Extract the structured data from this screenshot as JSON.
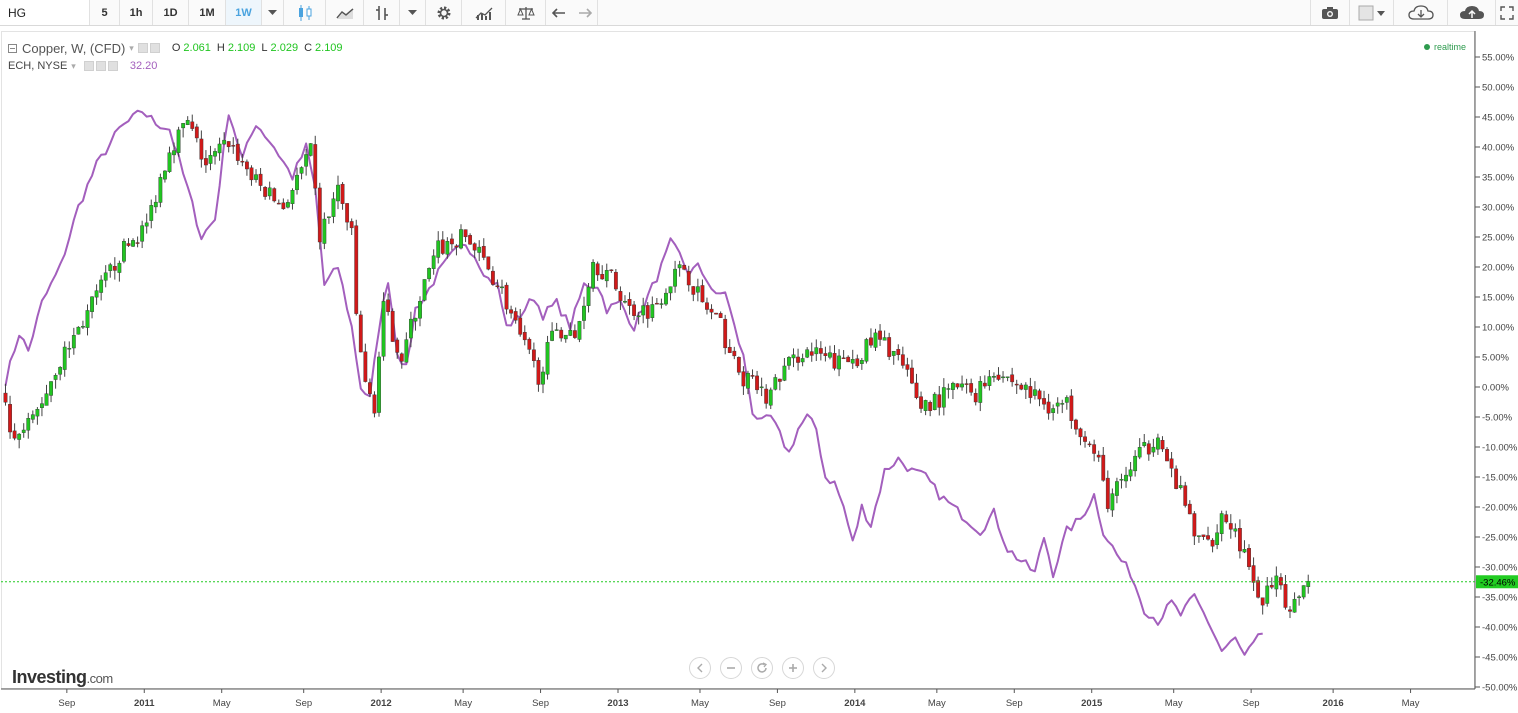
{
  "toolbar": {
    "symbol_value": "HG",
    "intervals": [
      "5",
      "1h",
      "1D",
      "1M",
      "1W"
    ],
    "active_interval": "1W"
  },
  "legend": {
    "main_name": "Copper, W, (CFD)",
    "o_label": "O",
    "o_value": "2.061",
    "h_label": "H",
    "h_value": "2.109",
    "l_label": "L",
    "l_value": "2.029",
    "c_label": "C",
    "c_value": "2.109",
    "compare_name": "ECH, NYSE",
    "compare_value": "32.20"
  },
  "realtime_label": "realtime",
  "logo": {
    "main": "Investing",
    "suffix": ".com"
  },
  "colors": {
    "up": "#21c521",
    "down": "#d11919",
    "compare_line": "#a35fbd",
    "current_line": "#22cc22"
  },
  "chart_data": {
    "type": "candlestick_with_compare_line",
    "y_axis": {
      "unit": "%",
      "ticks": [
        "55.00%",
        "50.00%",
        "45.00%",
        "40.00%",
        "35.00%",
        "30.00%",
        "25.00%",
        "20.00%",
        "15.00%",
        "10.00%",
        "5.00%",
        "0.00%",
        "-5.00%",
        "-10.00%",
        "-15.00%",
        "-20.00%",
        "-25.00%",
        "-30.00%",
        "-35.00%",
        "-40.00%",
        "-45.00%",
        "-50.00%"
      ],
      "ylim": [
        -51,
        56
      ]
    },
    "x_axis": {
      "ticks": [
        "Sep",
        "2011",
        "May",
        "Sep",
        "2012",
        "May",
        "Sep",
        "2013",
        "May",
        "Sep",
        "2014",
        "May",
        "Sep",
        "2015",
        "May",
        "Sep",
        "2016",
        "May"
      ],
      "bold_ticks": [
        "2011",
        "2012",
        "2013",
        "2014",
        "2015",
        "2016"
      ],
      "range_weeks": [
        -14,
        299
      ]
    },
    "current_value_label": "-32.46%",
    "current_value": -32.46,
    "main_series": {
      "name": "Copper, W, (CFD)",
      "anchors": [
        [
          0,
          -1
        ],
        [
          3,
          -10
        ],
        [
          8,
          -4
        ],
        [
          12,
          3
        ],
        [
          18,
          11
        ],
        [
          26,
          22
        ],
        [
          32,
          27
        ],
        [
          37,
          40
        ],
        [
          41,
          44
        ],
        [
          45,
          37
        ],
        [
          50,
          41
        ],
        [
          56,
          34
        ],
        [
          62,
          30
        ],
        [
          66,
          36
        ],
        [
          68,
          39
        ],
        [
          70,
          25
        ],
        [
          74,
          33
        ],
        [
          77,
          25
        ],
        [
          78,
          12
        ],
        [
          80,
          0
        ],
        [
          82,
          -3
        ],
        [
          84,
          13
        ],
        [
          88,
          5
        ],
        [
          92,
          15
        ],
        [
          96,
          23
        ],
        [
          102,
          25
        ],
        [
          106,
          21
        ],
        [
          110,
          16
        ],
        [
          114,
          8
        ],
        [
          118,
          2
        ],
        [
          122,
          10
        ],
        [
          126,
          8
        ],
        [
          130,
          21
        ],
        [
          134,
          18
        ],
        [
          138,
          13
        ],
        [
          143,
          13
        ],
        [
          147,
          18
        ],
        [
          150,
          20
        ],
        [
          154,
          14
        ],
        [
          158,
          10
        ],
        [
          162,
          2
        ],
        [
          166,
          0
        ],
        [
          168,
          -2
        ],
        [
          172,
          3
        ],
        [
          176,
          6
        ],
        [
          180,
          5
        ],
        [
          184,
          4
        ],
        [
          188,
          5
        ],
        [
          192,
          8
        ],
        [
          196,
          6
        ],
        [
          198,
          3
        ],
        [
          202,
          -3
        ],
        [
          206,
          -2
        ],
        [
          210,
          0
        ],
        [
          214,
          -1
        ],
        [
          218,
          3
        ],
        [
          222,
          1
        ],
        [
          226,
          -1
        ],
        [
          230,
          -3
        ],
        [
          234,
          -3
        ],
        [
          238,
          -8
        ],
        [
          241,
          -13
        ],
        [
          243,
          -19
        ],
        [
          246,
          -16
        ],
        [
          249,
          -12
        ],
        [
          252,
          -10
        ],
        [
          254,
          -7
        ],
        [
          256,
          -13
        ],
        [
          258,
          -16
        ],
        [
          260,
          -20
        ],
        [
          263,
          -26
        ],
        [
          266,
          -25
        ],
        [
          268,
          -21
        ],
        [
          271,
          -24
        ],
        [
          273,
          -28
        ],
        [
          275,
          -34
        ],
        [
          277,
          -35
        ],
        [
          280,
          -33
        ],
        [
          282,
          -36
        ],
        [
          284,
          -36
        ],
        [
          286,
          -32
        ]
      ]
    },
    "compare_series": {
      "name": "ECH, NYSE",
      "anchors": [
        [
          0,
          1
        ],
        [
          3,
          9
        ],
        [
          5,
          6
        ],
        [
          8,
          14
        ],
        [
          12,
          20
        ],
        [
          16,
          30
        ],
        [
          20,
          37
        ],
        [
          25,
          43
        ],
        [
          30,
          46
        ],
        [
          33,
          44
        ],
        [
          36,
          43
        ],
        [
          40,
          33
        ],
        [
          43,
          25
        ],
        [
          46,
          28
        ],
        [
          49,
          46
        ],
        [
          52,
          38
        ],
        [
          55,
          44
        ],
        [
          59,
          40
        ],
        [
          63,
          35
        ],
        [
          66,
          40
        ],
        [
          68,
          33
        ],
        [
          70,
          17
        ],
        [
          73,
          20
        ],
        [
          76,
          10
        ],
        [
          78,
          0
        ],
        [
          80,
          -2
        ],
        [
          82,
          10
        ],
        [
          84,
          18
        ],
        [
          86,
          6
        ],
        [
          88,
          3
        ],
        [
          90,
          13
        ],
        [
          92,
          15
        ],
        [
          95,
          19
        ],
        [
          98,
          22
        ],
        [
          101,
          24
        ],
        [
          103,
          22
        ],
        [
          106,
          18
        ],
        [
          108,
          17
        ],
        [
          110,
          10
        ],
        [
          113,
          12
        ],
        [
          116,
          15
        ],
        [
          118,
          12
        ],
        [
          121,
          14
        ],
        [
          124,
          10
        ],
        [
          127,
          17
        ],
        [
          130,
          17
        ],
        [
          132,
          13
        ],
        [
          135,
          14
        ],
        [
          138,
          10
        ],
        [
          141,
          15
        ],
        [
          144,
          20
        ],
        [
          146,
          24
        ],
        [
          148,
          22
        ],
        [
          150,
          19
        ],
        [
          152,
          20
        ],
        [
          154,
          18
        ],
        [
          156,
          15
        ],
        [
          158,
          16
        ],
        [
          160,
          10
        ],
        [
          162,
          5
        ],
        [
          164,
          -4
        ],
        [
          166,
          -6
        ],
        [
          168,
          -5
        ],
        [
          170,
          -8
        ],
        [
          172,
          -11
        ],
        [
          174,
          -7
        ],
        [
          176,
          -5
        ],
        [
          178,
          -7
        ],
        [
          180,
          -15
        ],
        [
          182,
          -16
        ],
        [
          184,
          -20
        ],
        [
          186,
          -26
        ],
        [
          188,
          -20
        ],
        [
          190,
          -23
        ],
        [
          193,
          -14
        ],
        [
          196,
          -12
        ],
        [
          199,
          -14
        ],
        [
          202,
          -15
        ],
        [
          205,
          -18
        ],
        [
          208,
          -20
        ],
        [
          211,
          -22
        ],
        [
          214,
          -24
        ],
        [
          217,
          -21
        ],
        [
          220,
          -27
        ],
        [
          223,
          -29
        ],
        [
          226,
          -31
        ],
        [
          228,
          -25
        ],
        [
          230,
          -31
        ],
        [
          233,
          -24
        ],
        [
          236,
          -22
        ],
        [
          239,
          -18
        ],
        [
          241,
          -24
        ],
        [
          244,
          -28
        ],
        [
          247,
          -31
        ],
        [
          250,
          -37
        ],
        [
          253,
          -39
        ],
        [
          256,
          -36
        ],
        [
          258,
          -38
        ],
        [
          261,
          -35
        ],
        [
          264,
          -39
        ],
        [
          267,
          -44
        ],
        [
          270,
          -42
        ],
        [
          272,
          -45
        ],
        [
          274,
          -43
        ],
        [
          276,
          -41
        ]
      ]
    }
  }
}
